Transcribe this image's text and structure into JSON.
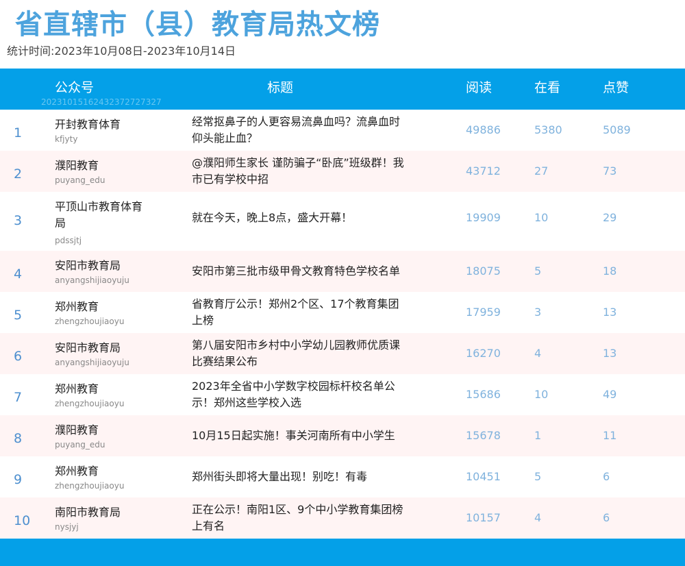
{
  "page": {
    "title": "省直辖市（县）教育局热文榜",
    "period": "统计时间:2023年10月08日-2023年10月14日"
  },
  "table": {
    "headers": {
      "account": "公众号",
      "title": "标题",
      "read": "阅读",
      "watch": "在看",
      "like": "点赞"
    },
    "watermark": "20231015162432372727327",
    "rows": [
      {
        "rank": "1",
        "account": "开封教育体育",
        "account_id": "kfjyty",
        "title": "经常抠鼻子的人更容易流鼻血吗？流鼻血时仰头能止血？",
        "read": "49886",
        "watch": "5380",
        "like": "5089"
      },
      {
        "rank": "2",
        "account": "濮阳教育",
        "account_id": "puyang_edu",
        "title": "@濮阳师生家长  谨防骗子“卧底”班级群！我市已有学校中招",
        "read": "43712",
        "watch": "27",
        "like": "73"
      },
      {
        "rank": "3",
        "account": "平顶山市教育体育局",
        "account_id": "pdssjtj",
        "title": "就在今天，晚上8点，盛大开幕！",
        "read": "19909",
        "watch": "10",
        "like": "29"
      },
      {
        "rank": "4",
        "account": "安阳市教育局",
        "account_id": "anyangshijiaoyuju",
        "title": "安阳市第三批市级甲骨文教育特色学校名单",
        "read": "18075",
        "watch": "5",
        "like": "18"
      },
      {
        "rank": "5",
        "account": "郑州教育",
        "account_id": "zhengzhoujiaoyu",
        "title": "省教育厅公示！郑州2个区、17个教育集团上榜",
        "read": "17959",
        "watch": "3",
        "like": "13"
      },
      {
        "rank": "6",
        "account": "安阳市教育局",
        "account_id": "anyangshijiaoyuju",
        "title": "第八届安阳市乡村中小学幼儿园教师优质课比赛结果公布",
        "read": "16270",
        "watch": "4",
        "like": "13"
      },
      {
        "rank": "7",
        "account": "郑州教育",
        "account_id": "zhengzhoujiaoyu",
        "title": "2023年全省中小学数字校园标杆校名单公示！郑州这些学校入选",
        "read": "15686",
        "watch": "10",
        "like": "49"
      },
      {
        "rank": "8",
        "account": "濮阳教育",
        "account_id": "puyang_edu",
        "title": "10月15日起实施！事关河南所有中小学生",
        "read": "15678",
        "watch": "1",
        "like": "11"
      },
      {
        "rank": "9",
        "account": "郑州教育",
        "account_id": "zhengzhoujiaoyu",
        "title": "郑州街头即将大量出现！别吃！有毒",
        "read": "10451",
        "watch": "5",
        "like": "6"
      },
      {
        "rank": "10",
        "account": "南阳市教育局",
        "account_id": "nysjyj",
        "title": "正在公示！南阳1区、9个中小学教育集团榜上有名",
        "read": "10157",
        "watch": "4",
        "like": "6"
      }
    ]
  },
  "colors": {
    "header_bg": "#04a0e8",
    "title_color": "#4da3dd",
    "alt_row_bg": "#fff4f4"
  }
}
